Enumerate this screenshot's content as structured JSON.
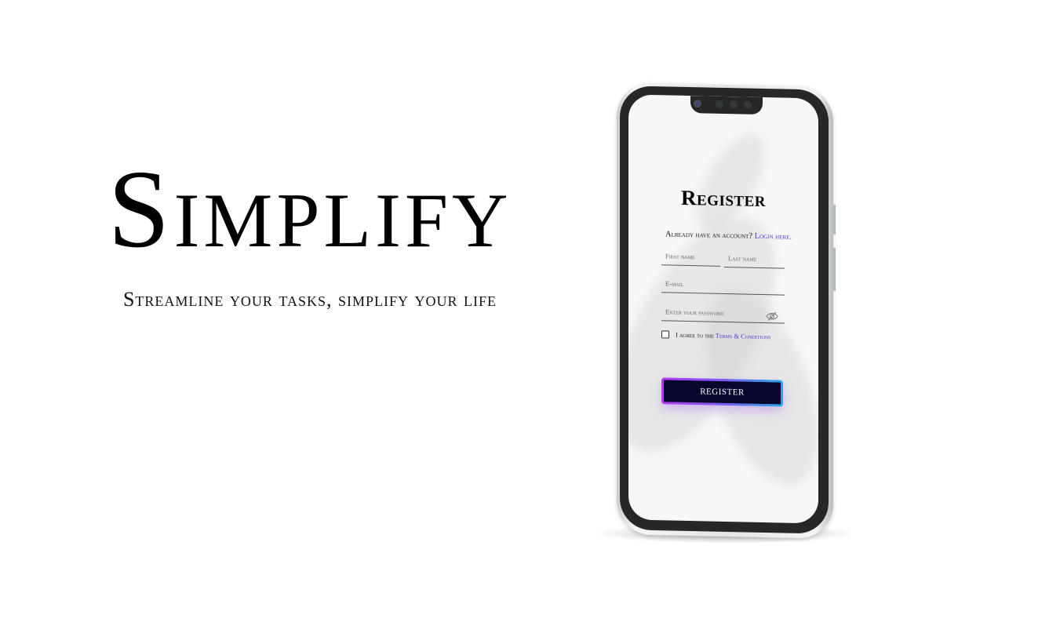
{
  "hero": {
    "brand": "Simplify",
    "tagline": "Streamline your tasks, simplify your life"
  },
  "register": {
    "title": "Register",
    "login_prompt": "Already have an account?",
    "login_link": "Login here.",
    "first_name_placeholder": "First name",
    "last_name_placeholder": "Last name",
    "email_placeholder": "E-mail",
    "password_placeholder": "Enter your password",
    "password_toggle_icon": "eye-off-icon",
    "terms_prefix": "I agree to the",
    "terms_link": "Terms & Conditions",
    "submit_label": "REGISTER"
  },
  "colors": {
    "link": "#4b39c9",
    "button_bg": "#07062e",
    "button_border_start": "#b43cf0",
    "button_border_end": "#2aa6e6"
  }
}
